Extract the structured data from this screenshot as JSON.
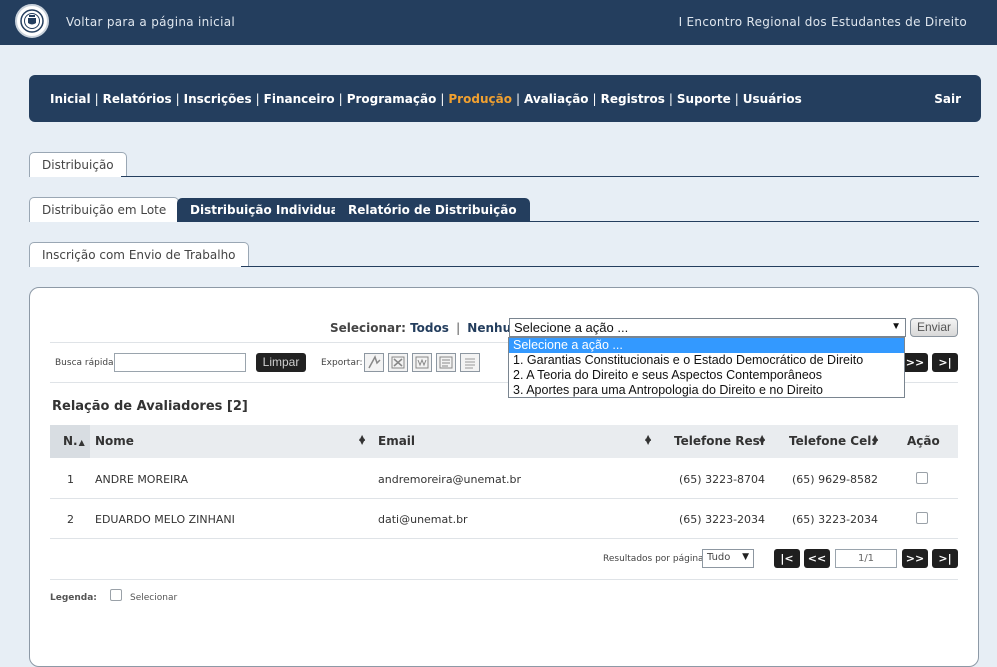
{
  "header": {
    "home_link": "Voltar para a página inicial",
    "event_title": "I Encontro Regional dos Estudantes de Direito"
  },
  "nav": {
    "items": [
      "Inicial",
      "Relatórios",
      "Inscrições",
      "Financeiro",
      "Programação",
      "Produção",
      "Avaliação",
      "Registros",
      "Suporte",
      "Usuários"
    ],
    "separator": "|",
    "active": "Produção",
    "logout": "Sair"
  },
  "tabs": {
    "level1": "Distribuição",
    "level2": [
      "Distribuição em Lote",
      "Distribuição Individual",
      "Relatório de Distribuição"
    ],
    "level3": "Inscrição com Envio de Trabalho"
  },
  "toolbar": {
    "select_label": "Selecionar:",
    "select_all": "Todos",
    "select_sep": "|",
    "select_none": "Nenhum",
    "action_placeholder": "Selecione a ação ...",
    "send_button": "Enviar",
    "quick_search_label": "Busca rápida:",
    "quick_search_value": "",
    "clear_button": "Limpar",
    "export_label": "Exportar:",
    "export_icons": [
      "pdf-export-icon",
      "excel-export-icon",
      "word-export-icon",
      "csv-export-icon",
      "text-export-icon"
    ]
  },
  "dropdown": {
    "options": [
      "Selecione a ação ...",
      "1. Garantias Constitucionais e o Estado Democrático de Direito",
      "2. A Teoria do Direito e seus Aspectos Contemporâneos",
      "3. Aportes para uma Antropologia do Direito e no Direito"
    ],
    "highlighted_index": 0
  },
  "table": {
    "title": "Relação de Avaliadores [2]",
    "columns": [
      "N.",
      "Nome",
      "Email",
      "Telefone Res.",
      "Telefone Cel.",
      "Ação"
    ],
    "rows": [
      {
        "num": "1",
        "name": "ANDRE MOREIRA",
        "email": "andremoreira@unemat.br",
        "phone_res": "(65) 3223-8704",
        "phone_cel": "(65) 9629-8582",
        "checked": false
      },
      {
        "num": "2",
        "name": "EDUARDO MELO ZINHANI",
        "email": "dati@unemat.br",
        "phone_res": "(65) 3223-2034",
        "phone_cel": "(65) 3223-2034",
        "checked": false
      }
    ]
  },
  "pagination": {
    "results_label": "Resultados por página:",
    "results_value": "Tudo",
    "page_value": "1/1",
    "first": "|<",
    "prev": "<<",
    "next": ">>",
    "last": ">|"
  },
  "legend": {
    "label": "Legenda:",
    "select_text": "Selecionar"
  },
  "colors": {
    "primary": "#243e5e",
    "active_nav": "#f0a030",
    "highlight": "#3399ff",
    "background": "#e7eef5"
  }
}
